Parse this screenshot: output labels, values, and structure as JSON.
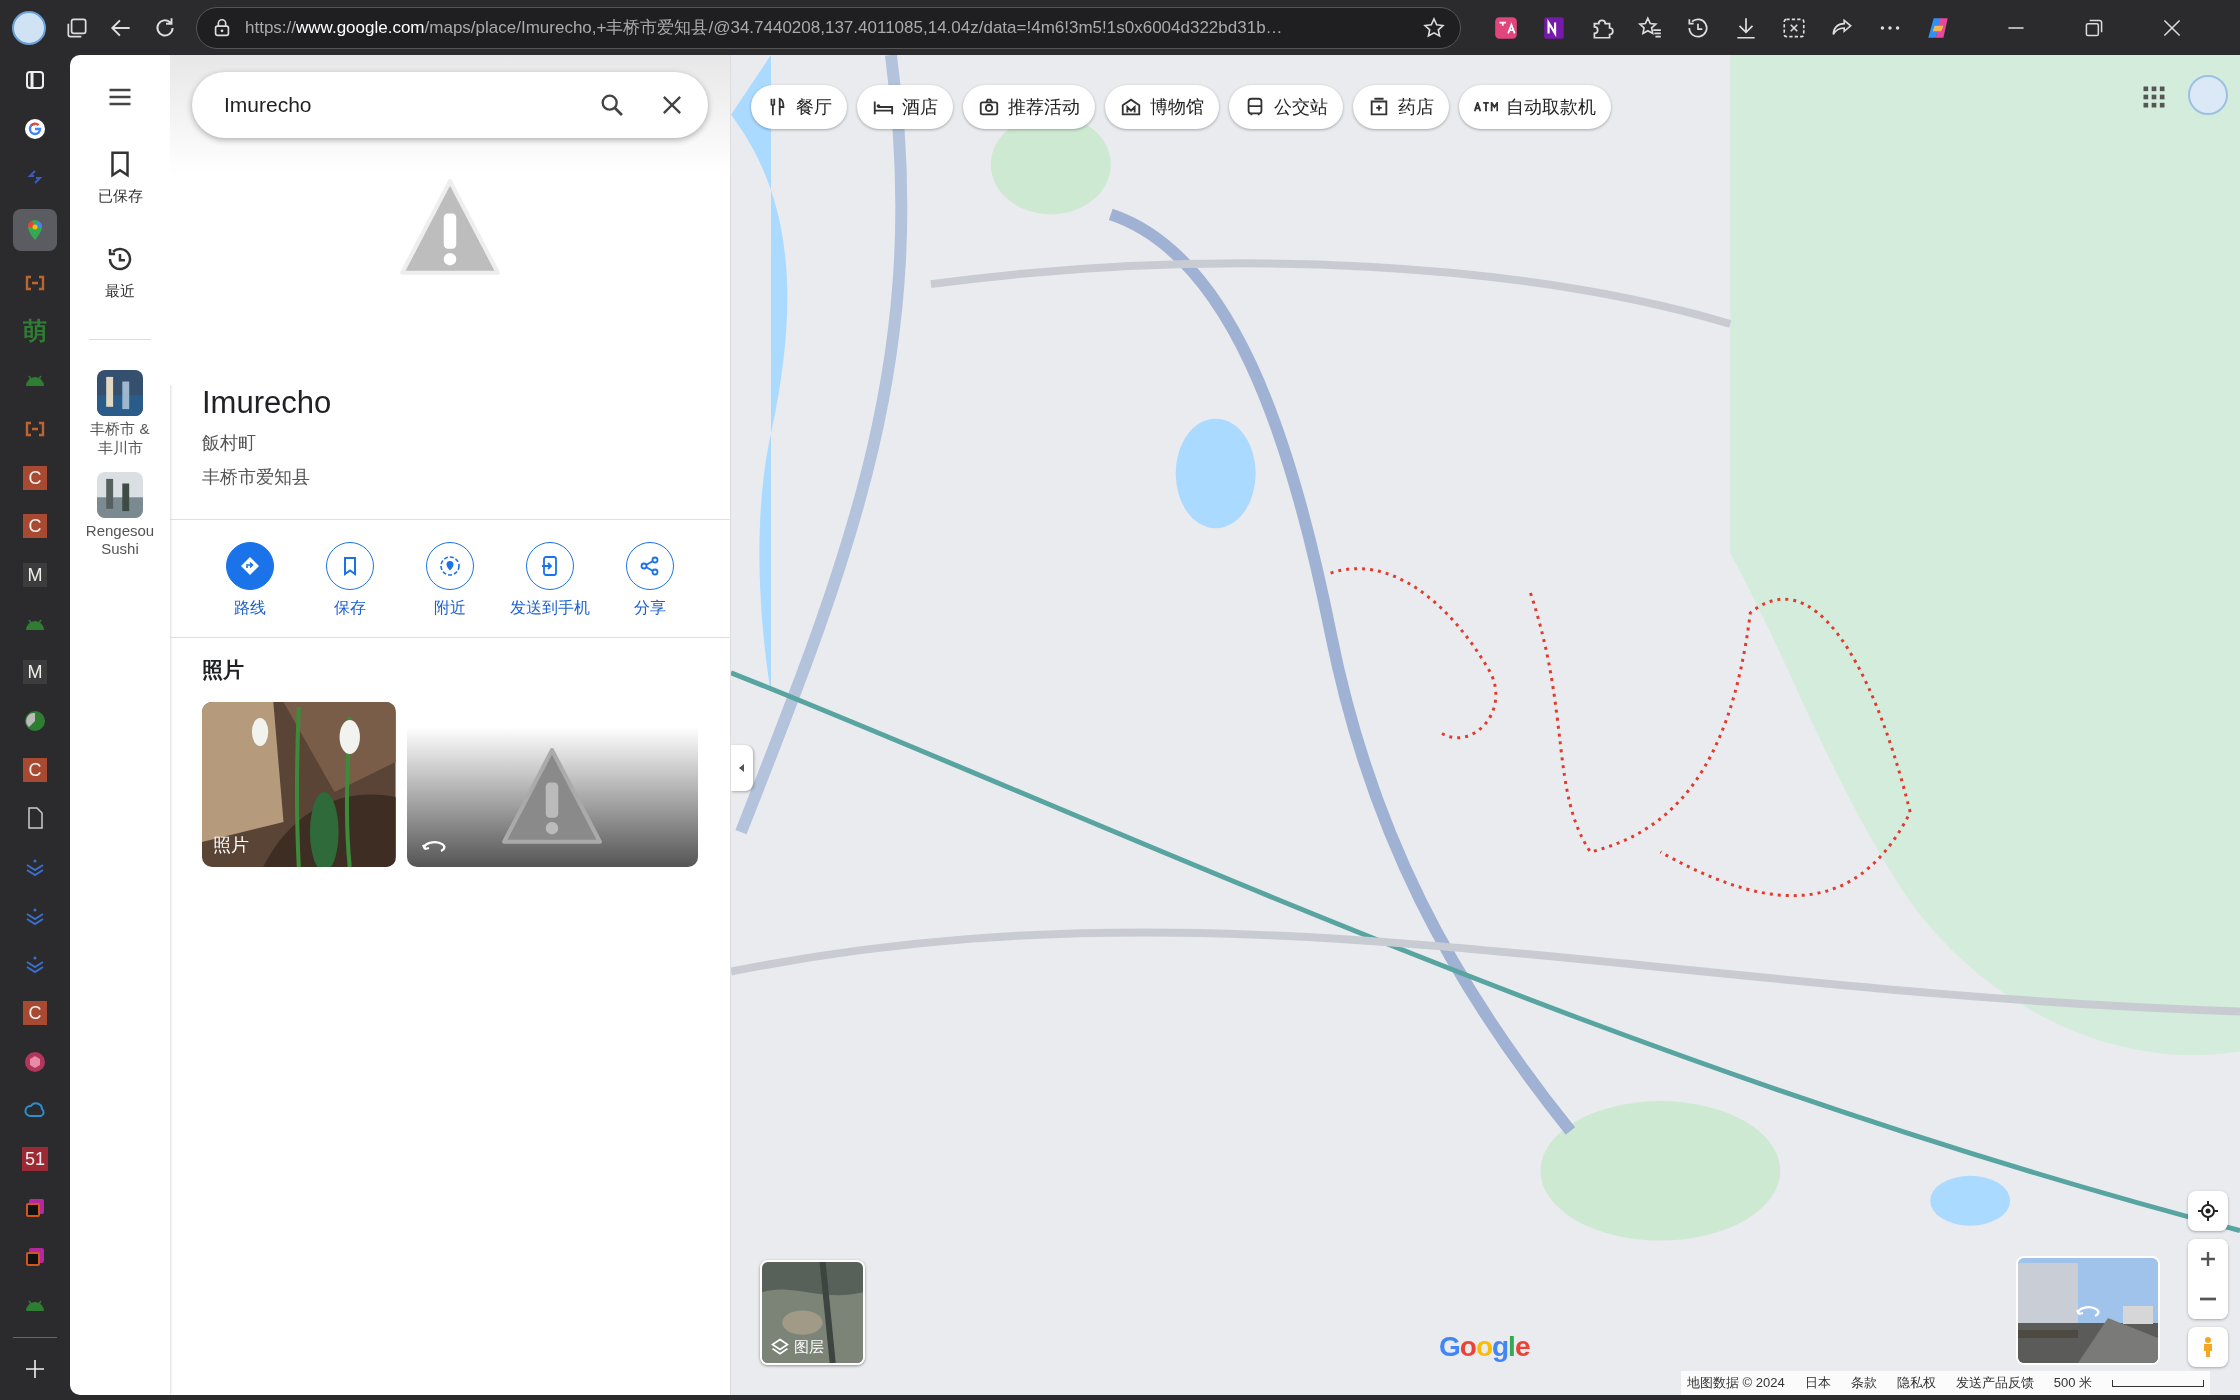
{
  "browser": {
    "url": "https://**www.google.com**/maps/place/Imurecho,+丰桥市爱知县/@34.7440208,137.4011085,14.04z/data=!4m6!3m5!1s0x6004d322bd31b…",
    "toolbar": [
      {
        "kind": "translate"
      },
      {
        "kind": "onenote"
      },
      {
        "kind": "extensions"
      },
      {
        "kind": "favorites"
      },
      {
        "kind": "history"
      },
      {
        "kind": "downloads"
      },
      {
        "kind": "screenshot"
      },
      {
        "kind": "share"
      },
      {
        "kind": "more"
      },
      {
        "kind": "copilot"
      }
    ]
  },
  "sidebar": [
    {
      "kind": "layout",
      "selected": false
    },
    {
      "kind": "google",
      "selected": false
    },
    {
      "kind": "arrows",
      "selected": false
    },
    {
      "kind": "maps",
      "selected": true
    },
    {
      "kind": "bracket",
      "selected": false
    },
    {
      "kind": "letter",
      "text": "萌",
      "color": "#2e7d32",
      "selected": false
    },
    {
      "kind": "android",
      "selected": false
    },
    {
      "kind": "bracket",
      "selected": false
    },
    {
      "kind": "tile",
      "text": "C",
      "color": "#a84a32",
      "selected": false
    },
    {
      "kind": "tile",
      "text": "C",
      "color": "#a84a32",
      "selected": false
    },
    {
      "kind": "tile",
      "text": "M",
      "color": "#3c3c3c",
      "selected": false
    },
    {
      "kind": "android",
      "selected": false
    },
    {
      "kind": "tile",
      "text": "M",
      "color": "#3c3c3c",
      "selected": false
    },
    {
      "kind": "pie",
      "selected": false
    },
    {
      "kind": "tile",
      "text": "C",
      "color": "#a84a32",
      "selected": false
    },
    {
      "kind": "file",
      "selected": false
    },
    {
      "kind": "chevrons",
      "selected": false
    },
    {
      "kind": "chevrons",
      "selected": false
    },
    {
      "kind": "chevrons",
      "selected": false
    },
    {
      "kind": "tile",
      "text": "C",
      "color": "#a84a32",
      "selected": false
    },
    {
      "kind": "cube",
      "selected": false
    },
    {
      "kind": "cloud",
      "selected": false
    },
    {
      "kind": "tile",
      "text": "51",
      "color": "#9c2a35",
      "selected": false
    },
    {
      "kind": "terminal",
      "selected": false
    },
    {
      "kind": "terminal",
      "selected": false
    },
    {
      "kind": "android",
      "selected": false
    }
  ],
  "rail": {
    "items": [
      {
        "kind": "saved",
        "label": "已保存"
      },
      {
        "kind": "recent",
        "label": "最近"
      }
    ],
    "recent": [
      {
        "label": "丰桥市 &\n丰川市"
      },
      {
        "label": "Rengesou\nSushi"
      }
    ]
  },
  "search": {
    "value": "Imurecho"
  },
  "place": {
    "title": "Imurecho",
    "lines": [
      "飯村町",
      "丰桥市爱知县"
    ]
  },
  "actions": [
    {
      "kind": "directions",
      "label": "路线",
      "primary": true
    },
    {
      "kind": "save",
      "label": "保存",
      "primary": false
    },
    {
      "kind": "nearby",
      "label": "附近",
      "primary": false
    },
    {
      "kind": "phone",
      "label": "发送到手机",
      "primary": false
    },
    {
      "kind": "share",
      "label": "分享",
      "primary": false
    }
  ],
  "photos": {
    "heading": "照片",
    "tiles": [
      {
        "kind": "picture",
        "label": "照片"
      },
      {
        "kind": "street_view"
      }
    ]
  },
  "chips": [
    {
      "kind": "restaurant",
      "label": "餐厅"
    },
    {
      "kind": "hotel",
      "label": "酒店"
    },
    {
      "kind": "camera",
      "label": "推荐活动"
    },
    {
      "kind": "museum",
      "label": "博物馆"
    },
    {
      "kind": "bus",
      "label": "公交站"
    },
    {
      "kind": "pharmacy",
      "label": "药店"
    },
    {
      "kind": "atm",
      "label": "自动取款机"
    }
  ],
  "map": {
    "layers_label": "图层",
    "logo": "Google",
    "footer": [
      "地图数据 © 2024",
      "日本",
      "条款",
      "隐私权",
      "发送产品反馈"
    ],
    "scale": "500 米"
  }
}
